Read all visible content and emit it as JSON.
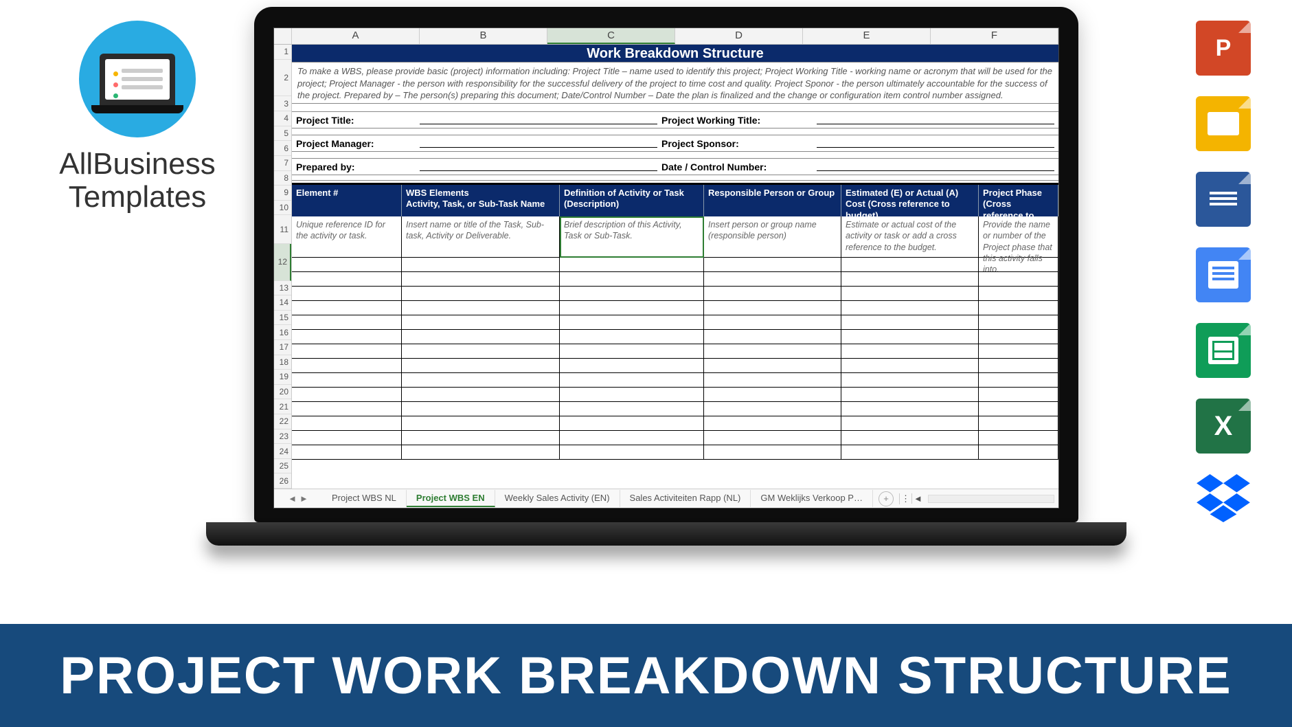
{
  "brand": {
    "line1": "AllBusiness",
    "line2": "Templates"
  },
  "banner": "PROJECT WORK BREAKDOWN STRUCTURE",
  "spreadsheet": {
    "columns": [
      "A",
      "B",
      "C",
      "D",
      "E",
      "F"
    ],
    "selected_column_index": 2,
    "title": "Work Breakdown Structure",
    "instructions": "To make a WBS, please provide basic (project) information including: Project Title – name used to identify this project; Project Working Title - working name or acronym that will be used for the project; Project Manager - the person with responsibility for the successful delivery of the project to time cost and quality. Project Sponor - the person ultimately accountable for the success of the project. Prepared by – The person(s) preparing this document; Date/Control Number – Date the plan is finalized and the change or configuration item control number assigned.",
    "meta": [
      {
        "left": "Project Title:",
        "right": "Project Working Title:"
      },
      {
        "left": "Project Manager:",
        "right": "Project Sponsor:"
      },
      {
        "left": "Prepared by:",
        "right": "Date / Control Number:"
      }
    ],
    "headers": [
      "Element #",
      "WBS Elements\nActivity, Task, or Sub-Task Name",
      "Definition of Activity or Task (Description)",
      "Responsible Person or Group",
      "Estimated (E) or Actual (A) Cost (Cross reference to budget)",
      "Project Phase (Cross reference to schedule)"
    ],
    "hints": [
      "Unique reference ID for the activity or task.",
      "Insert name or title of the Task, Sub-task, Activity or Deliverable.",
      "Brief description of this Activity, Task or Sub-Task.",
      "Insert person or group name (responsible person)",
      "Estimate or actual cost of the activity or task or add a cross reference to the budget.",
      "Provide the name or number of the Project phase that this activity falls into."
    ],
    "row_numbers": [
      1,
      2,
      3,
      4,
      5,
      6,
      7,
      8,
      9,
      10,
      11,
      12,
      13,
      14,
      15,
      16,
      17,
      18,
      19,
      20,
      21,
      22,
      23,
      24,
      25,
      26
    ],
    "empty_rows": 14,
    "tabs": [
      "Project WBS NL",
      "Project WBS EN",
      "Weekly Sales Activity (EN)",
      "Sales Activiteiten Rapp (NL)",
      "GM Weklijks Verkoop P…"
    ],
    "active_tab_index": 1
  },
  "right_icons": [
    {
      "name": "powerpoint-icon",
      "label": "P"
    },
    {
      "name": "google-slides-icon",
      "label": ""
    },
    {
      "name": "word-icon",
      "label": "W"
    },
    {
      "name": "google-docs-icon",
      "label": ""
    },
    {
      "name": "google-sheets-icon",
      "label": ""
    },
    {
      "name": "excel-icon",
      "label": "X"
    },
    {
      "name": "dropbox-icon",
      "label": ""
    }
  ]
}
